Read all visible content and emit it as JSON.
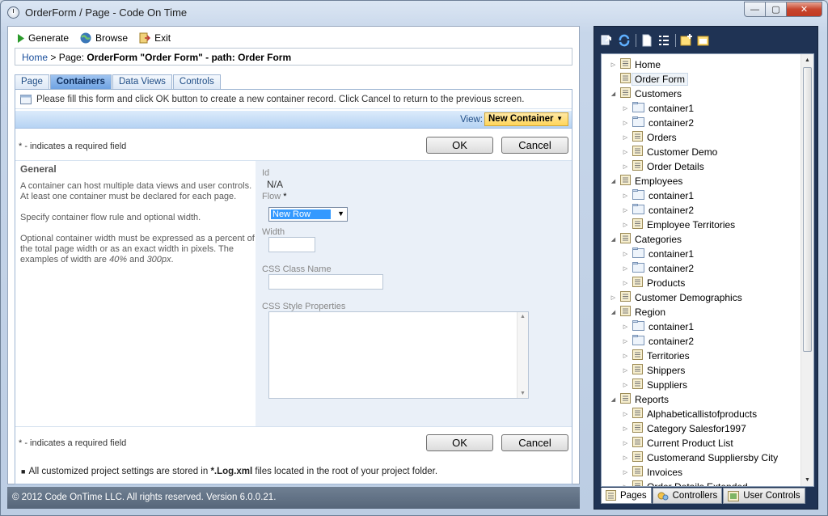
{
  "window": {
    "title": "OrderForm / Page - Code On Time",
    "minimize": "—",
    "maximize": "▢",
    "close": "✕"
  },
  "toolbar": {
    "generate": "Generate",
    "browse": "Browse",
    "exit": "Exit"
  },
  "breadcrumb": {
    "home": "Home",
    "separator": " > ",
    "text_prefix": "Page: ",
    "text_bold": "OrderForm \"Order Form\" - path: Order Form"
  },
  "tabs": [
    {
      "label": "Page"
    },
    {
      "label": "Containers"
    },
    {
      "label": "Data Views"
    },
    {
      "label": "Controls"
    }
  ],
  "form": {
    "info": "Please fill this form and click OK button to create a new container record. Click Cancel to return to the previous screen.",
    "view_label": "View:",
    "view_value": "New Container",
    "required_note": "* - indicates a required field",
    "ok": "OK",
    "cancel": "Cancel",
    "section_title": "General",
    "desc1": "A container can host multiple data views and user controls. At least one container must be declared for each page.",
    "desc2": "Specify container flow rule and optional width.",
    "desc3_a": "Optional container width must be expressed as a percent of the total page width or as an exact width in pixels. The examples of width are ",
    "desc3_b": "40%",
    "desc3_c": " and ",
    "desc3_d": "300px",
    "desc3_e": ".",
    "fields": {
      "id_label": "Id",
      "id_value": "N/A",
      "flow_label": "Flow",
      "flow_req": "*",
      "flow_value": "New Row",
      "width_label": "Width",
      "css_class_label": "CSS Class Name",
      "css_style_label": "CSS Style Properties"
    }
  },
  "footer_note": {
    "prefix": "All customized project settings are stored in ",
    "bold": "*.Log.xml",
    "suffix": " files located in the root of your project folder."
  },
  "status": "© 2012 Code OnTime LLC. All rights reserved. Version 6.0.0.21.",
  "tree": [
    {
      "label": "Home",
      "level": 0,
      "twisty": "▷",
      "icon": "page"
    },
    {
      "label": "Order Form",
      "level": 0,
      "twisty": "",
      "icon": "page",
      "selected": true
    },
    {
      "label": "Customers",
      "level": 0,
      "twisty": "◢",
      "icon": "page"
    },
    {
      "label": "container1",
      "level": 1,
      "twisty": "▷",
      "icon": "folder"
    },
    {
      "label": "container2",
      "level": 1,
      "twisty": "▷",
      "icon": "folder"
    },
    {
      "label": "Orders",
      "level": 1,
      "twisty": "▷",
      "icon": "page"
    },
    {
      "label": "Customer Demo",
      "level": 1,
      "twisty": "▷",
      "icon": "page"
    },
    {
      "label": "Order Details",
      "level": 1,
      "twisty": "▷",
      "icon": "page"
    },
    {
      "label": "Employees",
      "level": 0,
      "twisty": "◢",
      "icon": "page"
    },
    {
      "label": "container1",
      "level": 1,
      "twisty": "▷",
      "icon": "folder"
    },
    {
      "label": "container2",
      "level": 1,
      "twisty": "▷",
      "icon": "folder"
    },
    {
      "label": "Employee Territories",
      "level": 1,
      "twisty": "▷",
      "icon": "page"
    },
    {
      "label": "Categories",
      "level": 0,
      "twisty": "◢",
      "icon": "page"
    },
    {
      "label": "container1",
      "level": 1,
      "twisty": "▷",
      "icon": "folder"
    },
    {
      "label": "container2",
      "level": 1,
      "twisty": "▷",
      "icon": "folder"
    },
    {
      "label": "Products",
      "level": 1,
      "twisty": "▷",
      "icon": "page"
    },
    {
      "label": "Customer Demographics",
      "level": 0,
      "twisty": "▷",
      "icon": "page"
    },
    {
      "label": "Region",
      "level": 0,
      "twisty": "◢",
      "icon": "page"
    },
    {
      "label": "container1",
      "level": 1,
      "twisty": "▷",
      "icon": "folder"
    },
    {
      "label": "container2",
      "level": 1,
      "twisty": "▷",
      "icon": "folder"
    },
    {
      "label": "Territories",
      "level": 1,
      "twisty": "▷",
      "icon": "page"
    },
    {
      "label": "Shippers",
      "level": 1,
      "twisty": "▷",
      "icon": "page"
    },
    {
      "label": "Suppliers",
      "level": 1,
      "twisty": "▷",
      "icon": "page"
    },
    {
      "label": "Reports",
      "level": 0,
      "twisty": "◢",
      "icon": "page"
    },
    {
      "label": "Alphabeticallistofproducts",
      "level": 1,
      "twisty": "▷",
      "icon": "page"
    },
    {
      "label": "Category Salesfor1997",
      "level": 1,
      "twisty": "▷",
      "icon": "page"
    },
    {
      "label": "Current Product List",
      "level": 1,
      "twisty": "▷",
      "icon": "page"
    },
    {
      "label": "Customerand Suppliersby City",
      "level": 1,
      "twisty": "▷",
      "icon": "page"
    },
    {
      "label": "Invoices",
      "level": 1,
      "twisty": "▷",
      "icon": "page"
    },
    {
      "label": "Order Details Extended",
      "level": 1,
      "twisty": "▷",
      "icon": "page"
    }
  ],
  "bottom_tabs": [
    {
      "label": "Pages"
    },
    {
      "label": "Controllers"
    },
    {
      "label": "User Controls"
    }
  ],
  "colors": {
    "accent": "#6ea2e2",
    "view_highlight": "#ffd55b",
    "tree_background": "#1f3354"
  }
}
